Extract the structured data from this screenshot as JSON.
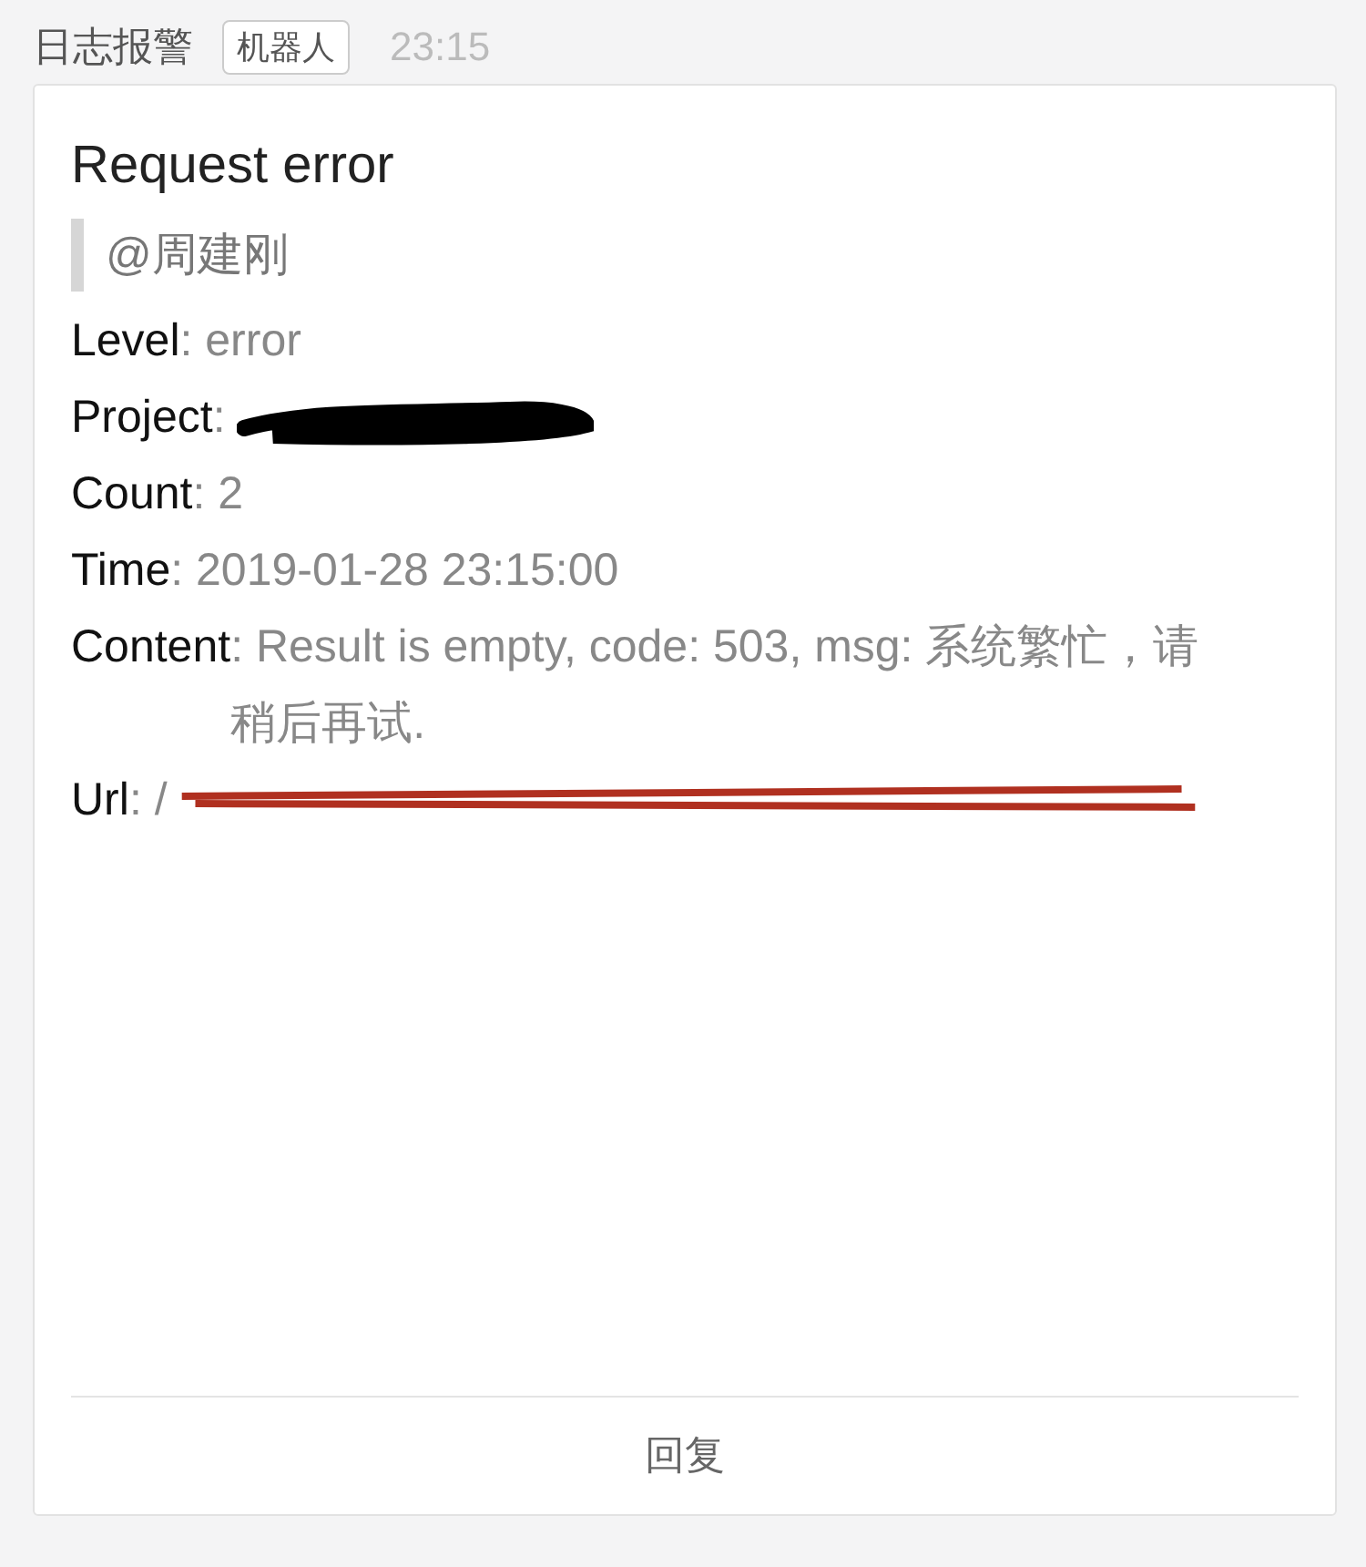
{
  "header": {
    "sender": "日志报警",
    "badge": "机器人",
    "time": "23:15"
  },
  "card": {
    "title": "Request error",
    "mention": "@周建刚",
    "fields": [
      {
        "label": "Level",
        "value": ": error",
        "kind": "plain"
      },
      {
        "label": "Project",
        "value": ":",
        "kind": "scribble"
      },
      {
        "label": "Count",
        "value": ": 2",
        "kind": "plain"
      },
      {
        "label": "Time",
        "value": ": 2019-01-28 23:15:00",
        "kind": "plain"
      },
      {
        "label": "Content",
        "value": ": Result is empty, code: 503, msg: 系统繁忙，请稍后再试.",
        "kind": "plain"
      },
      {
        "label": "Url",
        "value": ": /",
        "kind": "strike"
      }
    ],
    "reply": "回复"
  }
}
